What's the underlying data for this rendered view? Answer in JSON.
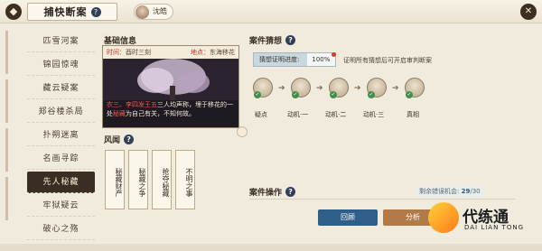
{
  "topbar": {
    "back_icon": "diamond-back-icon",
    "title": "捕快断案",
    "help": "?",
    "character_name": "沈皓",
    "close_icon": "close-icon"
  },
  "sidebar": {
    "items": [
      {
        "label": "匹雪河案"
      },
      {
        "label": "锦园惊魂"
      },
      {
        "label": "藏云疑案"
      },
      {
        "label": "郑谷楼杀局"
      },
      {
        "label": "扑朔迷离"
      },
      {
        "label": "名画寻踪"
      },
      {
        "label": "先人秘藏"
      },
      {
        "label": "牢狱疑云"
      },
      {
        "label": "破心之殇"
      }
    ],
    "active_index": 6
  },
  "basic": {
    "title": "基础信息",
    "time_label": "时间：",
    "time_value": "酉时三刻",
    "place_label": "地点：",
    "place_value": "东海移花",
    "text_prefix": "农三、",
    "text_hl1": "李四发王五",
    "text_mid": "三人均声称，埋于移花的一处",
    "text_hl2": "秘藏",
    "text_end": "为自己有关，不知何故。"
  },
  "fengwen": {
    "title": "风闻",
    "help": "?",
    "scrolls": [
      "秘藏财产",
      "秘藏之争",
      "抢夺秘藏",
      "不明之事"
    ]
  },
  "thought": {
    "title": "案件猜想",
    "help": "?",
    "progress_label": "猜想证明进度:",
    "progress_value": "100%",
    "hint": "证明所有猜想后可开启审判断案",
    "nodes": [
      "疑点",
      "动机·一",
      "动机·二",
      "动机·三",
      "真相"
    ]
  },
  "ops": {
    "title": "案件操作",
    "help": "?",
    "remaining_label": "剩余错误机会:",
    "remaining_current": "29",
    "remaining_total": "/30",
    "review_label": "回顾",
    "judge_label": "分析"
  },
  "logo": {
    "text": "代练通",
    "sub": "DAI LIAN TONG"
  }
}
